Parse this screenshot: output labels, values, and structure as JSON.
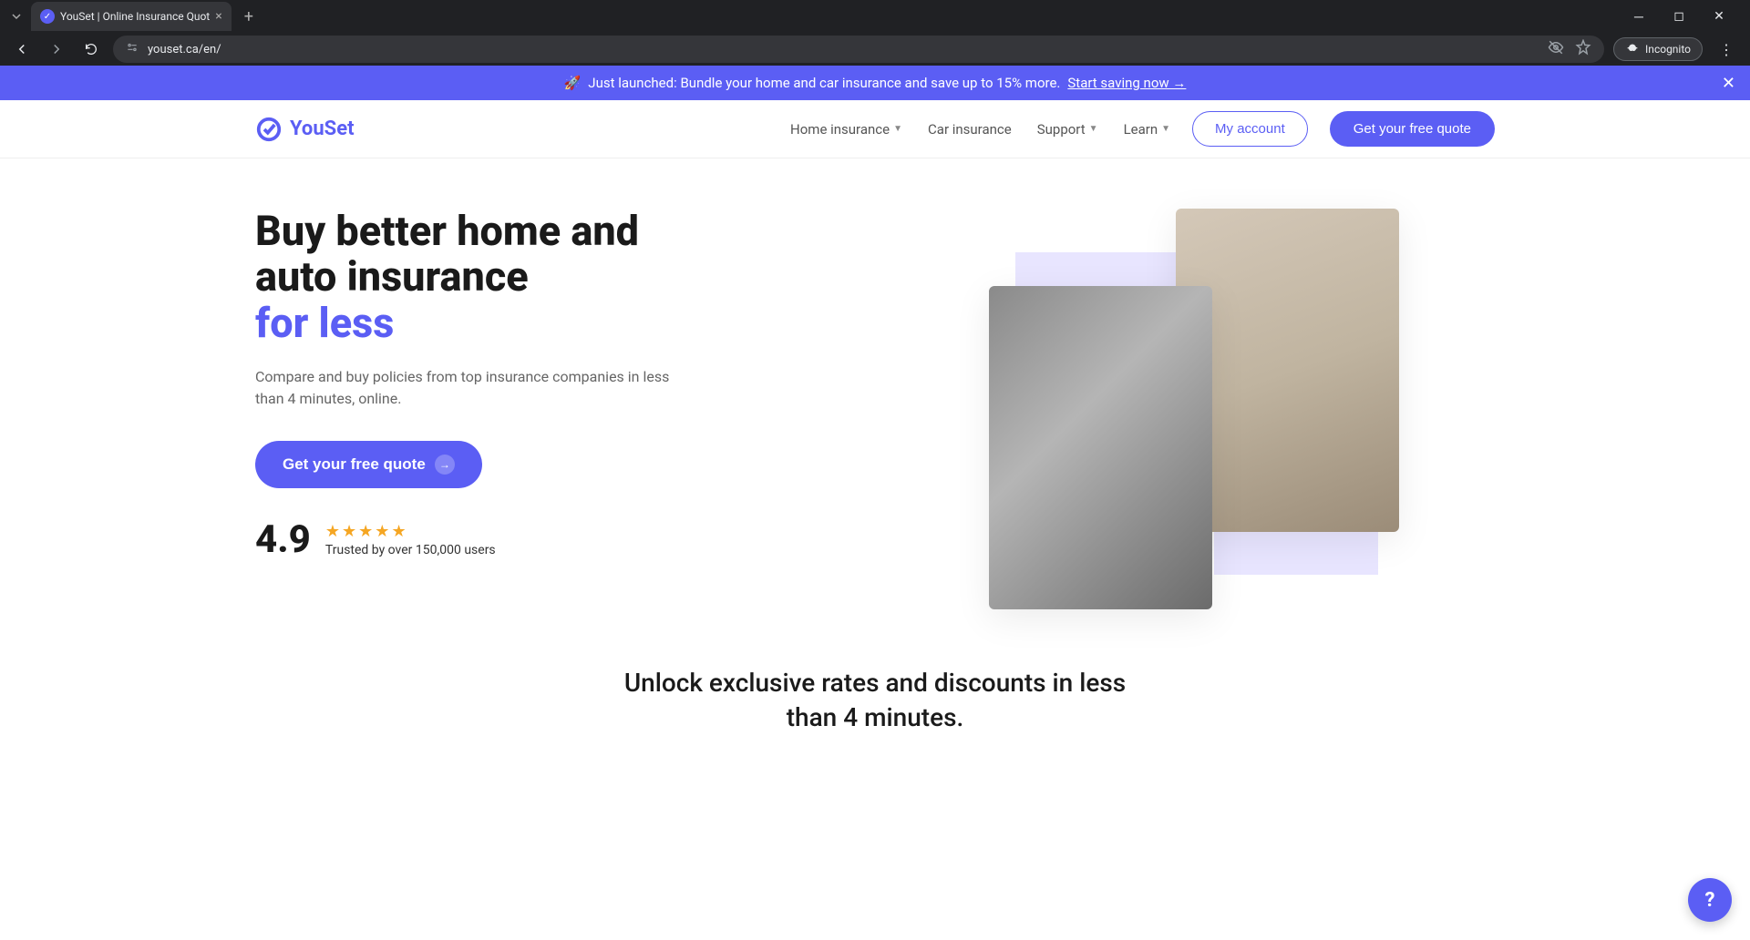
{
  "browser": {
    "tab_title": "YouSet | Online Insurance Quot",
    "url": "youset.ca/en/",
    "incognito_label": "Incognito"
  },
  "announcement": {
    "emoji": "🚀",
    "text": "Just launched: Bundle your home and car insurance and save up to 15% more.",
    "link": "Start saving now →"
  },
  "logo_text": "YouSet",
  "nav": {
    "home": "Home insurance",
    "car": "Car insurance",
    "support": "Support",
    "learn": "Learn"
  },
  "buttons": {
    "my_account": "My account",
    "get_quote": "Get your free quote"
  },
  "hero": {
    "title_line1": "Buy better home and auto insurance",
    "title_highlight": "for less",
    "subtitle": "Compare and buy policies from top insurance companies in less than 4 minutes, online.",
    "cta": "Get your free quote",
    "rating_value": "4.9",
    "trusted_text": "Trusted by over 150,000 users"
  },
  "section2_title": "Unlock exclusive rates and discounts in less than 4 minutes.",
  "help_label": "?",
  "colors": {
    "primary": "#5b5ef4",
    "lavender": "#e8e5ff",
    "star": "#f5a623"
  }
}
